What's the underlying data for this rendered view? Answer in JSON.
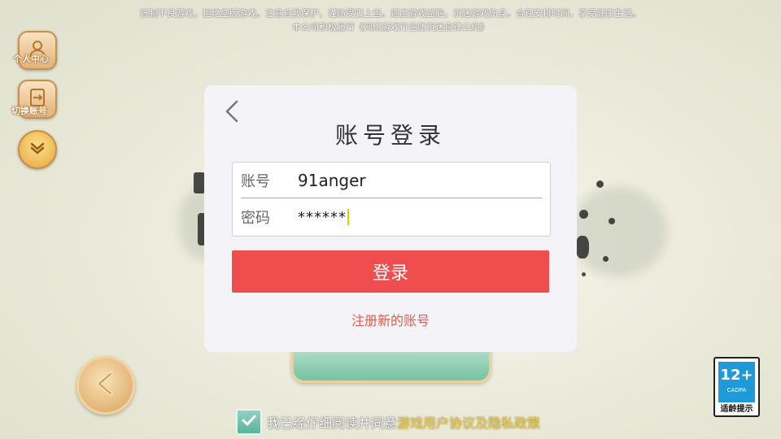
{
  "notice": {
    "line1": "抵制不良游戏，拒绝盗版游戏。注意自我保护，谨防受骗上当。适度游戏益脑，沉迷游戏伤身。合理安排时间，享受健康生活。",
    "line2": "本公司积极履行《网络游戏行业防沉迷自律公约》"
  },
  "sidebar": {
    "personal_center": "个人中心",
    "switch_account": "切换账号"
  },
  "login": {
    "title": "账号登录",
    "account_label": "账号",
    "account_value": "91anger",
    "password_label": "密码",
    "password_value": "******",
    "submit_label": "登录",
    "register_link": "注册新的账号"
  },
  "age_rating": {
    "number": "12+",
    "org": "CADPA",
    "tip": "适龄提示"
  },
  "agreement": {
    "prefix": "我已经仔细阅读并同意",
    "link": "游戏用户协议及隐私政策",
    "checked": true
  },
  "colors": {
    "login_button": "#f04d4f",
    "register_link": "#e85a4f",
    "panel_bg": "#f4f4f8",
    "age_badge": "#1e9ad8"
  },
  "icons": {
    "back": "chevron-left-icon",
    "personal": "user-icon",
    "switch": "switch-account-icon",
    "expand": "chevron-down-icon",
    "game_back": "arrow-left-icon",
    "check": "check-icon"
  }
}
